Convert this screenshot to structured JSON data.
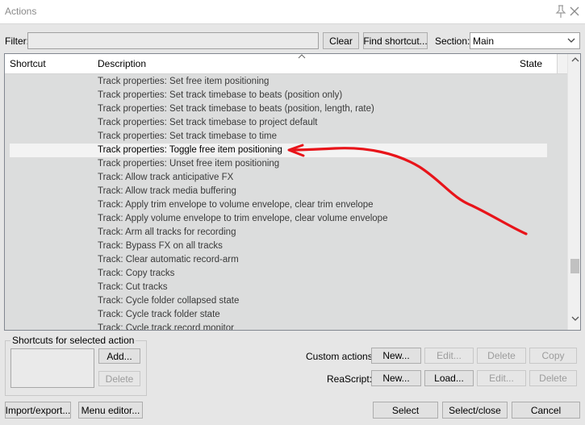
{
  "window": {
    "title": "Actions"
  },
  "filter": {
    "label": "Filter:",
    "value": "",
    "clear_label": "Clear",
    "find_shortcut_label": "Find shortcut..."
  },
  "section": {
    "label": "Section:",
    "selected": "Main"
  },
  "list": {
    "columns": [
      "Shortcut",
      "Description",
      "State"
    ],
    "rows": [
      "Track properties: Set free item positioning",
      "Track properties: Set track timebase to beats (position only)",
      "Track properties: Set track timebase to beats (position, length, rate)",
      "Track properties: Set track timebase to project default",
      "Track properties: Set track timebase to time",
      "Track properties: Toggle free item positioning",
      "Track properties: Unset free item positioning",
      "Track: Allow track anticipative FX",
      "Track: Allow track media buffering",
      "Track: Apply trim envelope to volume envelope, clear trim envelope",
      "Track: Apply volume envelope to trim envelope, clear volume envelope",
      "Track: Arm all tracks for recording",
      "Track: Bypass FX on all tracks",
      "Track: Clear automatic record-arm",
      "Track: Copy tracks",
      "Track: Cut tracks",
      "Track: Cycle folder collapsed state",
      "Track: Cycle track folder state",
      "Track: Cycle track record monitor"
    ],
    "selected_index": 5
  },
  "shortcuts_group": {
    "label": "Shortcuts for selected action",
    "add_label": "Add...",
    "delete_label": "Delete"
  },
  "custom_actions": {
    "label": "Custom actions:",
    "new_label": "New...",
    "edit_label": "Edit...",
    "delete_label": "Delete",
    "copy_label": "Copy"
  },
  "reascript": {
    "label": "ReaScript:",
    "new_label": "New...",
    "load_label": "Load...",
    "edit_label": "Edit...",
    "delete_label": "Delete"
  },
  "footer": {
    "import_export_label": "Import/export...",
    "menu_editor_label": "Menu editor...",
    "select_label": "Select",
    "select_close_label": "Select/close",
    "cancel_label": "Cancel"
  },
  "annotation": {
    "color": "#e8141a"
  }
}
